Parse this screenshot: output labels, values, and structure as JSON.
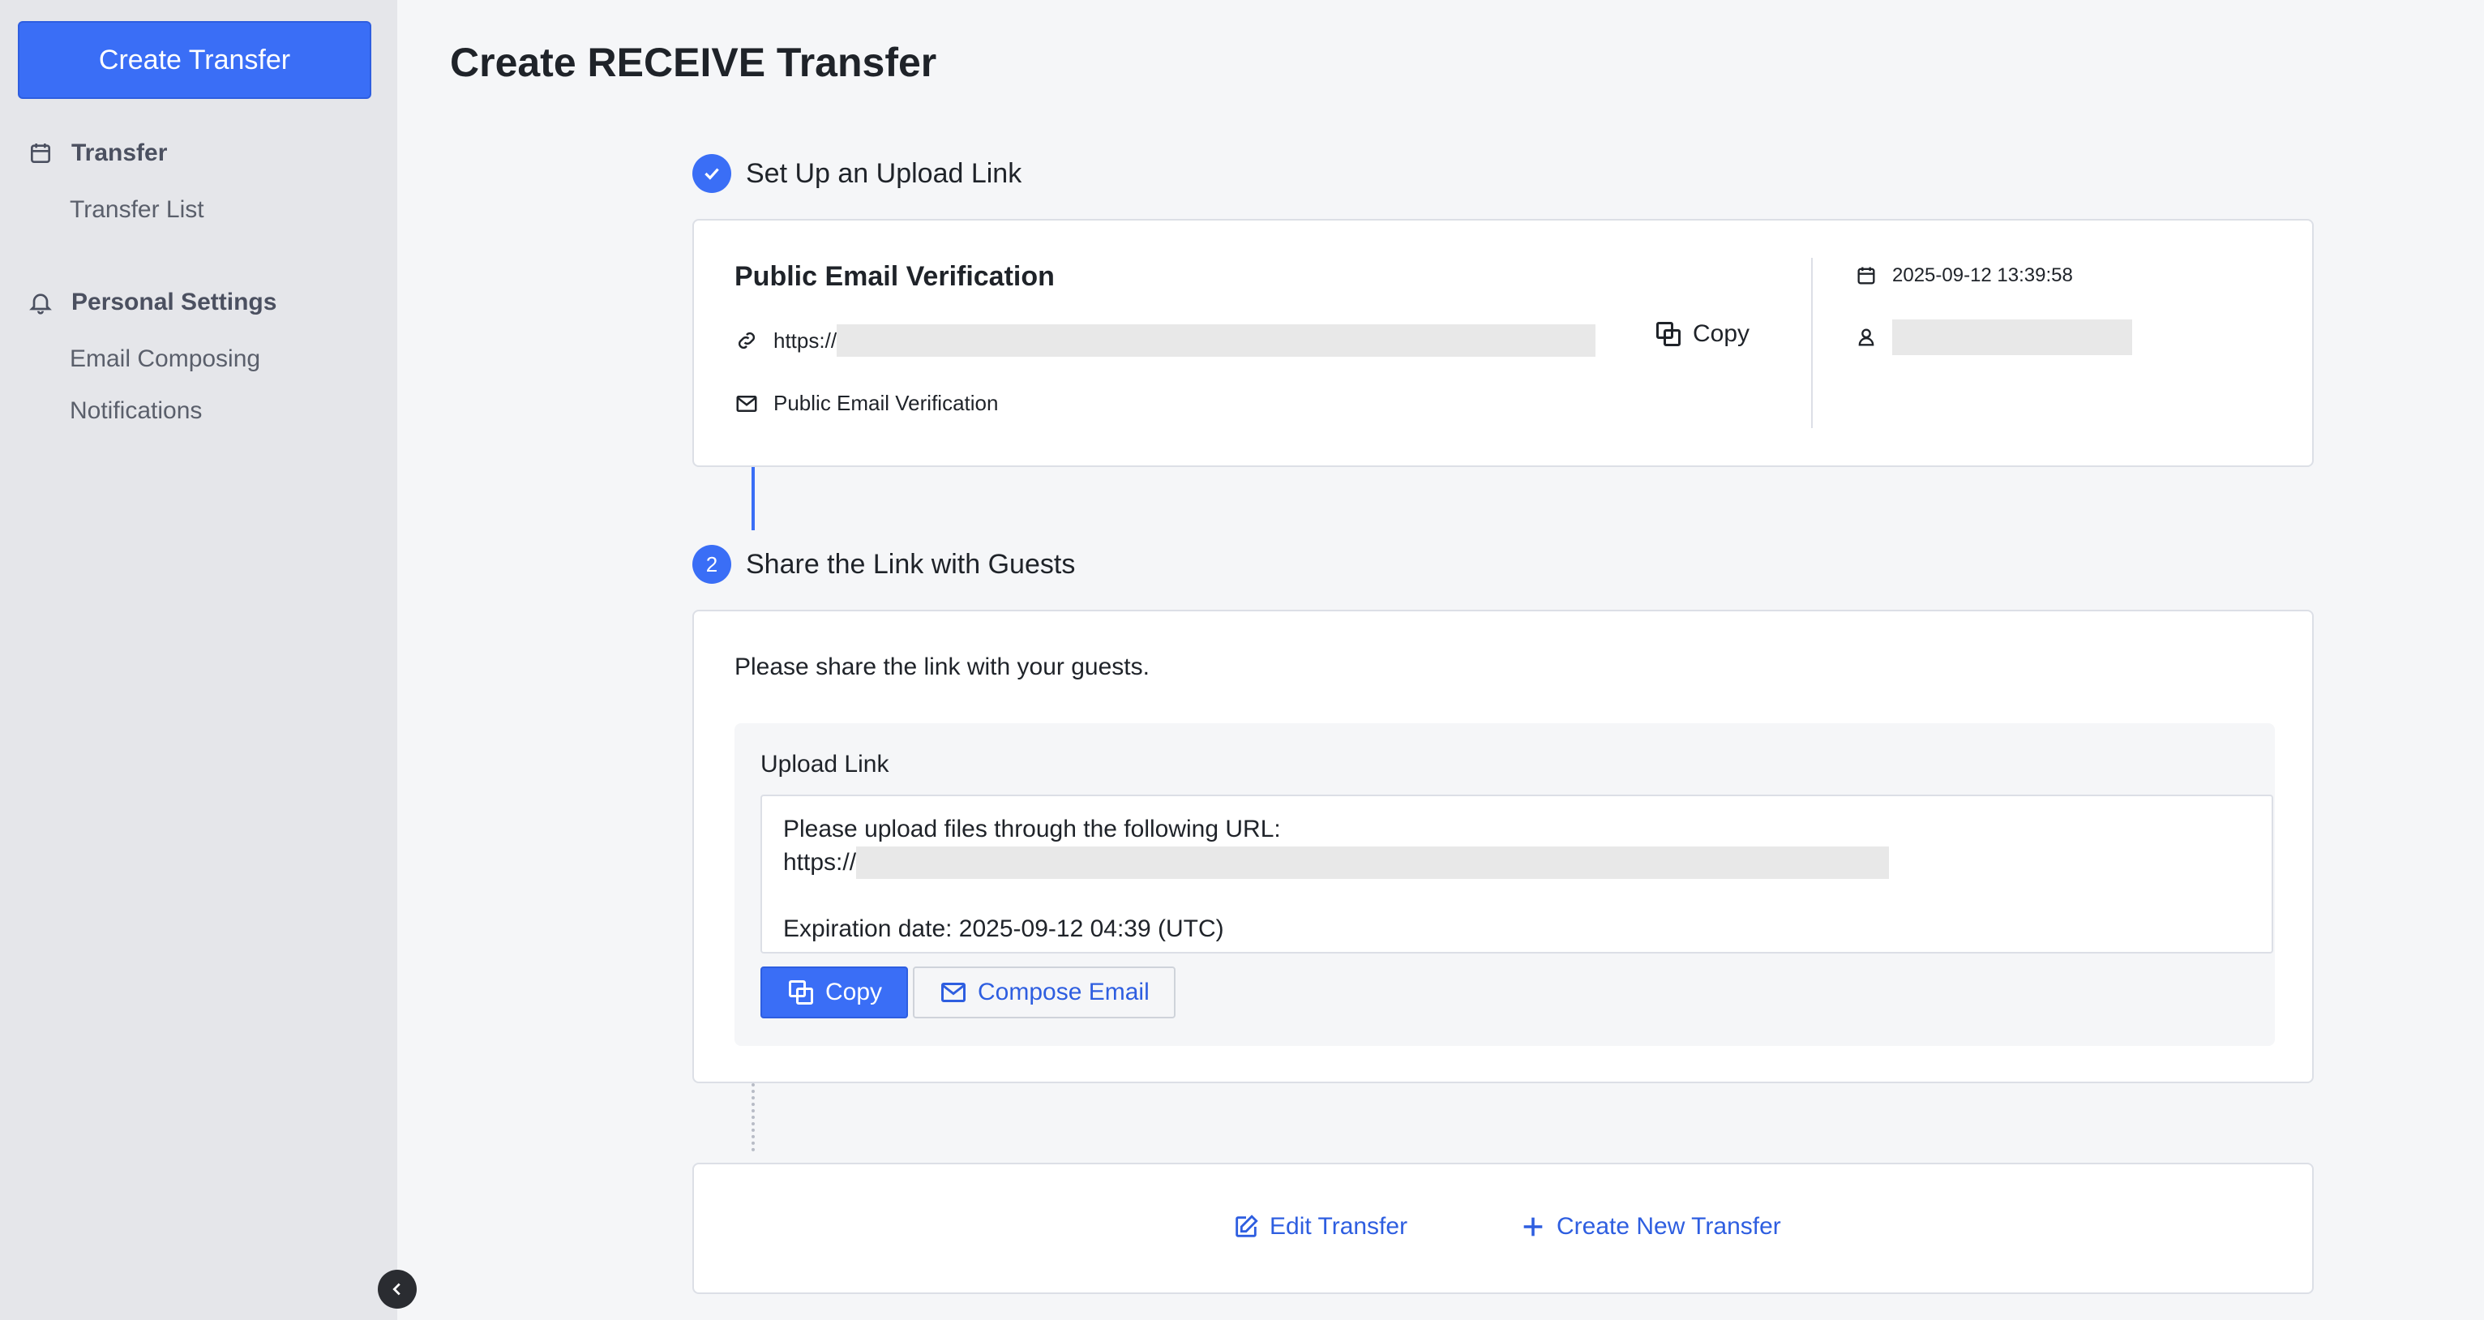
{
  "sidebar": {
    "create_button": "Create Transfer",
    "groups": [
      {
        "title": "Transfer",
        "icon": "calendar-icon",
        "items": [
          "Transfer List"
        ]
      },
      {
        "title": "Personal Settings",
        "icon": "bell-icon",
        "items": [
          "Email Composing",
          "Notifications"
        ]
      }
    ],
    "collapse_icon": "chevron-left-icon"
  },
  "page": {
    "title": "Create RECEIVE Transfer"
  },
  "step1": {
    "number": "",
    "state": "completed",
    "title": "Set Up an Upload Link",
    "card": {
      "heading": "Public Email Verification",
      "url_prefix": "https://",
      "copy_label": "Copy",
      "verification_label": "Public Email Verification",
      "date": "2025-09-12 13:39:58",
      "user": ""
    }
  },
  "step2": {
    "number": "2",
    "title": "Share the Link with Guests",
    "intro": "Please share the link with your guests.",
    "panel": {
      "label": "Upload Link",
      "line1": "Please upload files through the following URL:",
      "url_prefix": "https://",
      "expiration": "Expiration date: 2025-09-12 04:39 (UTC)",
      "copy_button": "Copy",
      "compose_button": "Compose Email"
    }
  },
  "actions": {
    "edit": "Edit Transfer",
    "create_new": "Create New Transfer"
  },
  "colors": {
    "primary": "#3a6ef6",
    "sidebar_bg": "#e5e6ea",
    "page_bg": "#f5f6f8",
    "link": "#2e5ee0"
  }
}
